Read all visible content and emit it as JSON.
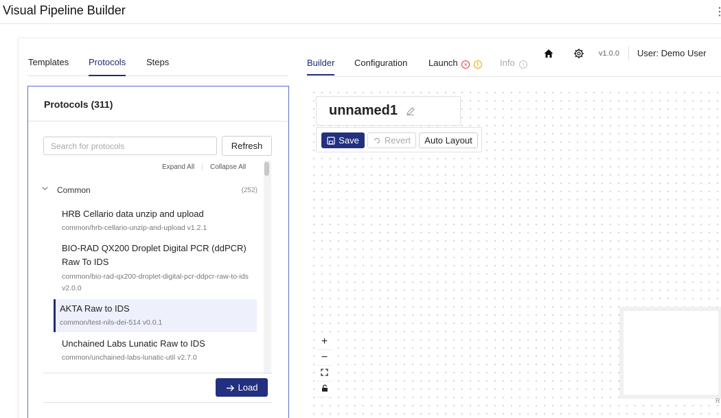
{
  "app": {
    "title": "Visual Pipeline Builder",
    "menu_icon": "kebab-menu-icon"
  },
  "left_tabs": [
    {
      "label": "Templates",
      "active": false
    },
    {
      "label": "Protocols",
      "active": true
    },
    {
      "label": "Steps",
      "active": false
    }
  ],
  "protocols": {
    "title": "Protocols (311)",
    "search_placeholder": "Search for protocols",
    "search_value": "",
    "refresh_label": "Refresh",
    "expand_all": "Expand All",
    "collapse_all": "Collapse All",
    "group": {
      "name": "Common",
      "count": "(252)",
      "expanded": true
    },
    "items": [
      {
        "name": "HRB Cellario data unzip and upload",
        "subtitle": "common/hrb-cellario-unzip-and-upload v1.2.1",
        "selected": false
      },
      {
        "name": "BIO-RAD QX200 Droplet Digital PCR (ddPCR) Raw To IDS",
        "subtitle": "common/bio-rad-qx200-droplet-digital-pcr-ddpcr-raw-to-ids v2.0.0",
        "selected": false
      },
      {
        "name": "AKTA Raw to IDS",
        "subtitle": "common/test-nils-dei-514 v0.0.1",
        "selected": true
      },
      {
        "name": "Unchained Labs Lunatic Raw to IDS",
        "subtitle": "common/unchained-labs-lunatic-util v2.7.0",
        "selected": false
      }
    ],
    "load_label": "Load"
  },
  "right_tabs": [
    {
      "label": "Builder",
      "active": true
    },
    {
      "label": "Configuration",
      "active": false
    },
    {
      "label": "Launch",
      "active": false,
      "status": [
        "error",
        "warning"
      ]
    },
    {
      "label": "Info",
      "active": false,
      "disabled": true
    }
  ],
  "top_bar": {
    "version": "v1.0.0",
    "user": "User: Demo User"
  },
  "canvas": {
    "pipeline_name": "unnamed1",
    "save_label": "Save",
    "revert_label": "Revert",
    "auto_layout_label": "Auto Layout",
    "zoom_controls": [
      "+",
      "−",
      "fit-view",
      "lock"
    ],
    "corner_text": "R"
  },
  "colors": {
    "primary": "#23307f",
    "active_tab": "#1f2a7a",
    "error": "#e53935",
    "warning": "#f2a100",
    "panel_border": "#5b6cc8"
  }
}
